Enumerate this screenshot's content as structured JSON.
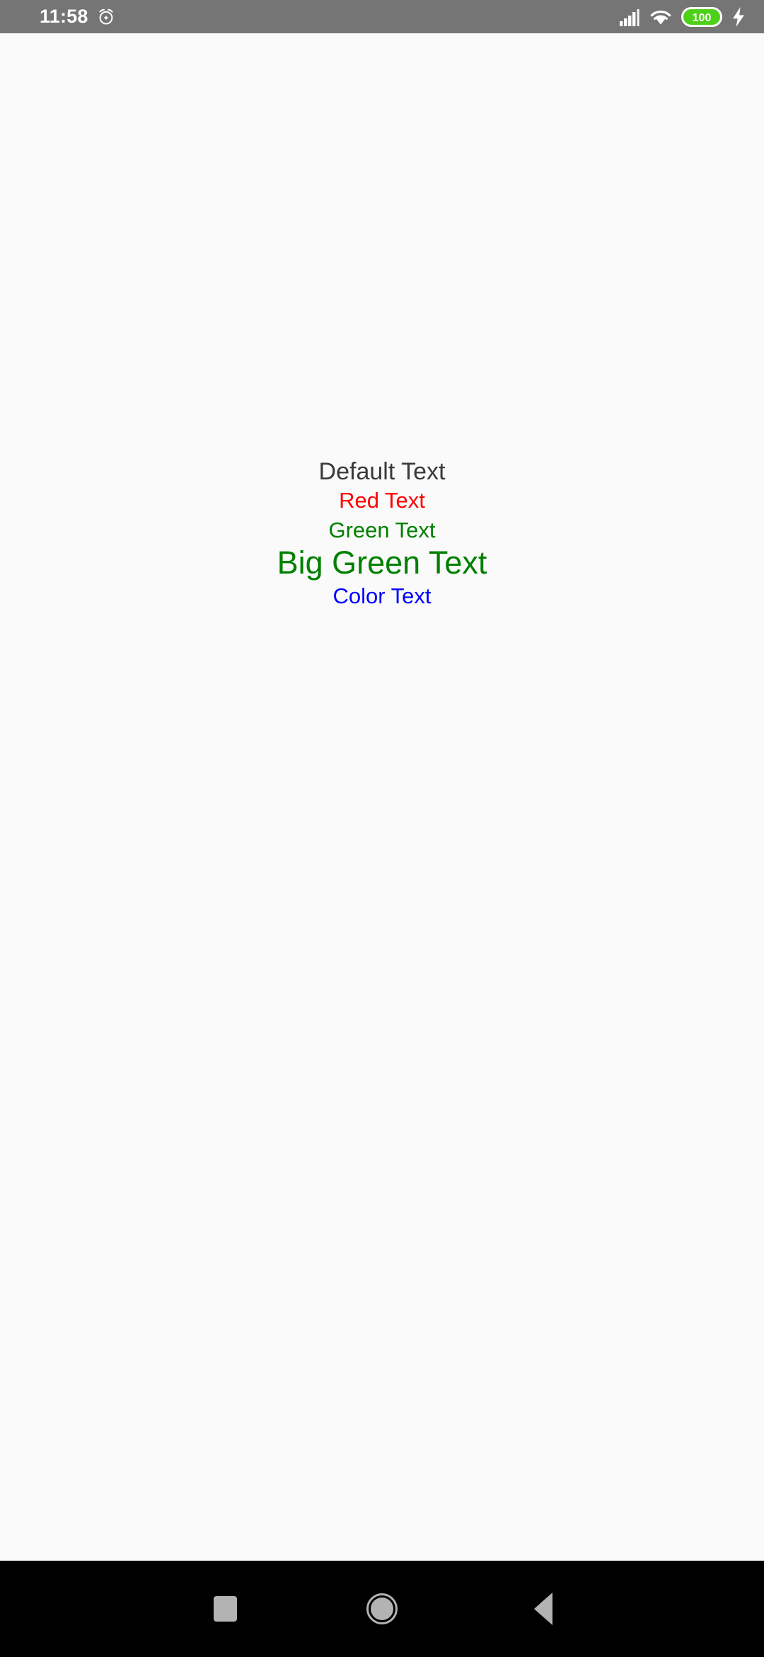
{
  "status_bar": {
    "time": "11:58",
    "background_color": "#757575",
    "foreground_color": "#FFFFFF",
    "icons": {
      "alarm": "alarm-icon",
      "signal": "cellular-signal-icon",
      "wifi": "wifi-icon",
      "battery": "battery-icon",
      "charging": "charging-bolt-icon"
    },
    "battery": {
      "level_label": "100",
      "fill_color": "#4CD018",
      "charging": true
    }
  },
  "app": {
    "background_color": "#FAFAFA",
    "texts": [
      {
        "label": "Default Text",
        "color": "#3A3A3A",
        "size_label": "normal"
      },
      {
        "label": "Red Text",
        "color": "#FF0000",
        "size_label": "normal"
      },
      {
        "label": "Green Text",
        "color": "#008000",
        "size_label": "normal"
      },
      {
        "label": "Big Green Text",
        "color": "#008000",
        "size_label": "large"
      },
      {
        "label": "Color Text",
        "color": "#0000FF",
        "size_label": "normal"
      }
    ]
  },
  "nav_bar": {
    "background_color": "#000000",
    "icon_color": "#B3B3B3",
    "buttons": [
      {
        "name": "recents",
        "icon": "square-icon"
      },
      {
        "name": "home",
        "icon": "circle-icon"
      },
      {
        "name": "back",
        "icon": "triangle-left-icon"
      }
    ]
  }
}
